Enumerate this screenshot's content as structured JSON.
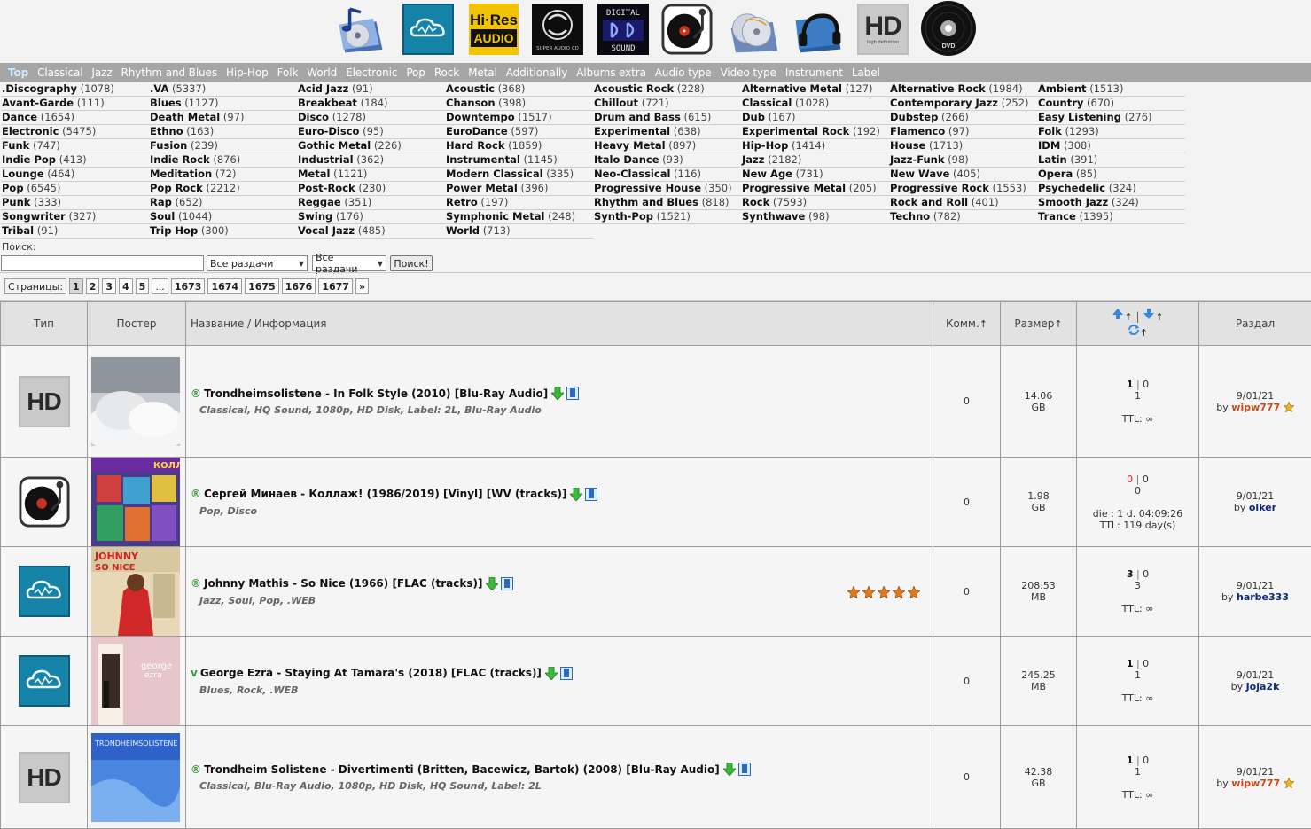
{
  "nav": [
    "Top",
    "Classical",
    "Jazz",
    "Rhythm and Blues",
    "Hip-Hop",
    "Folk",
    "World",
    "Electronic",
    "Pop",
    "Rock",
    "Metal",
    "Additionally",
    "Albums extra",
    "Audio type",
    "Video type",
    "Instrument",
    "Label"
  ],
  "top_icons": {
    "hires": {
      "line1": "Hi·Res",
      "line2": "AUDIO"
    },
    "sacd": {
      "text": "SUPER AUDIO CD"
    },
    "digital": {
      "line1": "DIGITAL",
      "line2": "SOUND"
    },
    "hd": {
      "text": "HD",
      "sub": "high definition"
    },
    "dvd": {
      "text": "DVD"
    }
  },
  "genres": [
    [
      {
        "name": ".Discography",
        "count": "(1078)"
      },
      {
        "name": "Avant-Garde",
        "count": "(111)"
      },
      {
        "name": "Dance",
        "count": "(1654)"
      },
      {
        "name": "Electronic",
        "count": "(5475)"
      },
      {
        "name": "Funk",
        "count": "(747)"
      },
      {
        "name": "Indie Pop",
        "count": "(413)"
      },
      {
        "name": "Lounge",
        "count": "(464)"
      },
      {
        "name": "Pop",
        "count": "(6545)"
      },
      {
        "name": "Punk",
        "count": "(333)"
      },
      {
        "name": "Songwriter",
        "count": "(327)"
      },
      {
        "name": "Tribal",
        "count": "(91)"
      }
    ],
    [
      {
        "name": ".VA",
        "count": "(5337)"
      },
      {
        "name": "Blues",
        "count": "(1127)"
      },
      {
        "name": "Death Metal",
        "count": "(97)"
      },
      {
        "name": "Ethno",
        "count": "(163)"
      },
      {
        "name": "Fusion",
        "count": "(239)"
      },
      {
        "name": "Indie Rock",
        "count": "(876)"
      },
      {
        "name": "Meditation",
        "count": "(72)"
      },
      {
        "name": "Pop Rock",
        "count": "(2212)"
      },
      {
        "name": "Rap",
        "count": "(652)"
      },
      {
        "name": "Soul",
        "count": "(1044)"
      },
      {
        "name": "Trip Hop",
        "count": "(300)"
      }
    ],
    [
      {
        "name": "Acid Jazz",
        "count": "(91)"
      },
      {
        "name": "Breakbeat",
        "count": "(184)"
      },
      {
        "name": "Disco",
        "count": "(1278)"
      },
      {
        "name": "Euro-Disco",
        "count": "(95)"
      },
      {
        "name": "Gothic Metal",
        "count": "(226)"
      },
      {
        "name": "Industrial",
        "count": "(362)"
      },
      {
        "name": "Metal",
        "count": "(1121)"
      },
      {
        "name": "Post-Rock",
        "count": "(230)"
      },
      {
        "name": "Reggae",
        "count": "(351)"
      },
      {
        "name": "Swing",
        "count": "(176)"
      },
      {
        "name": "Vocal Jazz",
        "count": "(485)"
      }
    ],
    [
      {
        "name": "Acoustic",
        "count": "(368)"
      },
      {
        "name": "Chanson",
        "count": "(398)"
      },
      {
        "name": "Downtempo",
        "count": "(1517)"
      },
      {
        "name": "EuroDance",
        "count": "(597)"
      },
      {
        "name": "Hard Rock",
        "count": "(1859)"
      },
      {
        "name": "Instrumental",
        "count": "(1145)"
      },
      {
        "name": "Modern Classical",
        "count": "(335)"
      },
      {
        "name": "Power Metal",
        "count": "(396)"
      },
      {
        "name": "Retro",
        "count": "(197)"
      },
      {
        "name": "Symphonic Metal",
        "count": "(248)"
      },
      {
        "name": "World",
        "count": "(713)"
      }
    ],
    [
      {
        "name": "Acoustic Rock",
        "count": "(228)"
      },
      {
        "name": "Chillout",
        "count": "(721)"
      },
      {
        "name": "Drum and Bass",
        "count": "(615)"
      },
      {
        "name": "Experimental",
        "count": "(638)"
      },
      {
        "name": "Heavy Metal",
        "count": "(897)"
      },
      {
        "name": "Italo Dance",
        "count": "(93)"
      },
      {
        "name": "Neo-Classical",
        "count": "(116)"
      },
      {
        "name": "Progressive House",
        "count": "(350)"
      },
      {
        "name": "Rhythm and Blues",
        "count": "(818)"
      },
      {
        "name": "Synth-Pop",
        "count": "(1521)"
      }
    ],
    [
      {
        "name": "Alternative Metal",
        "count": "(127)"
      },
      {
        "name": "Classical",
        "count": "(1028)"
      },
      {
        "name": "Dub",
        "count": "(167)"
      },
      {
        "name": "Experimental Rock",
        "count": "(192)"
      },
      {
        "name": "Hip-Hop",
        "count": "(1414)"
      },
      {
        "name": "Jazz",
        "count": "(2182)"
      },
      {
        "name": "New Age",
        "count": "(731)"
      },
      {
        "name": "Progressive Metal",
        "count": "(205)"
      },
      {
        "name": "Rock",
        "count": "(7593)"
      },
      {
        "name": "Synthwave",
        "count": "(98)"
      }
    ],
    [
      {
        "name": "Alternative Rock",
        "count": "(1984)"
      },
      {
        "name": "Contemporary Jazz",
        "count": "(252)"
      },
      {
        "name": "Dubstep",
        "count": "(266)"
      },
      {
        "name": "Flamenco",
        "count": "(97)"
      },
      {
        "name": "House",
        "count": "(1713)"
      },
      {
        "name": "Jazz-Funk",
        "count": "(98)"
      },
      {
        "name": "New Wave",
        "count": "(405)"
      },
      {
        "name": "Progressive Rock",
        "count": "(1553)"
      },
      {
        "name": "Rock and Roll",
        "count": "(401)"
      },
      {
        "name": "Techno",
        "count": "(782)"
      }
    ],
    [
      {
        "name": "Ambient",
        "count": "(1513)"
      },
      {
        "name": "Country",
        "count": "(670)"
      },
      {
        "name": "Easy Listening",
        "count": "(276)"
      },
      {
        "name": "Folk",
        "count": "(1293)"
      },
      {
        "name": "IDM",
        "count": "(308)"
      },
      {
        "name": "Latin",
        "count": "(391)"
      },
      {
        "name": "Opera",
        "count": "(85)"
      },
      {
        "name": "Psychedelic",
        "count": "(324)"
      },
      {
        "name": "Smooth Jazz",
        "count": "(324)"
      },
      {
        "name": "Trance",
        "count": "(1395)"
      }
    ]
  ],
  "search": {
    "label": "Поиск:",
    "value": "",
    "select1": "Все раздачи",
    "select2": "Все раздачи",
    "button": "Поиск!"
  },
  "pager": {
    "label": "Страницы:",
    "pages": [
      "1",
      "2",
      "3",
      "4",
      "5",
      "...",
      "1673",
      "1674",
      "1675",
      "1676",
      "1677",
      "»"
    ]
  },
  "table": {
    "headers": {
      "type": "Тип",
      "poster": "Постер",
      "name": "Название / Информация",
      "comments": "Комм.",
      "size": "Размер",
      "section": "Раздал"
    },
    "rows": [
      {
        "type_icon": "hd-icon",
        "poster": "poster-1",
        "status": "®",
        "title": "Trondheimsolistene - In Folk Style (2010) [Blu-Ray Audio]",
        "tags": "Classical, HQ Sound, 1080p, HD Disk, Label: 2L, Blu-Ray Audio",
        "comments": "0",
        "size_num": "14.06",
        "size_unit": "GB",
        "seed": "1",
        "leech": "0",
        "complete": "1",
        "extra": "",
        "ttl": "TTL: ∞",
        "date": "9/01/21",
        "by": "by",
        "user": "wipw777",
        "user_color": "red",
        "medal": true,
        "stars": 0
      },
      {
        "type_icon": "vinyl-icon",
        "poster": "poster-2",
        "status": "®",
        "title": "Сергей Минаев - Коллаж! (1986/2019) [Vinyl] [WV (tracks)]",
        "tags": "Pop, Disco",
        "comments": "0",
        "size_num": "1.98",
        "size_unit": "GB",
        "seed": "0",
        "leech": "0",
        "complete": "0",
        "extra": "die : 1 d. 04:09:26",
        "ttl": "TTL: 119 day(s)",
        "date": "9/01/21",
        "by": "by",
        "user": "olker",
        "user_color": "blue",
        "medal": false,
        "stars": 0
      },
      {
        "type_icon": "cloud-icon",
        "poster": "poster-3",
        "status": "®",
        "title": "Johnny Mathis - So Nice (1966) [FLAC (tracks)]",
        "tags": "Jazz, Soul, Pop, .WEB",
        "comments": "0",
        "size_num": "208.53",
        "size_unit": "MB",
        "seed": "3",
        "leech": "0",
        "complete": "3",
        "extra": "",
        "ttl": "TTL: ∞",
        "date": "9/01/21",
        "by": "by",
        "user": "harbe333",
        "user_color": "blue",
        "medal": false,
        "stars": 5
      },
      {
        "type_icon": "cloud-icon",
        "poster": "poster-4",
        "status": "v",
        "title": "George Ezra - Staying At Tamara's (2018) [FLAC (tracks)]",
        "tags": "Blues, Rock, .WEB",
        "comments": "0",
        "size_num": "245.25",
        "size_unit": "MB",
        "seed": "1",
        "leech": "0",
        "complete": "1",
        "extra": "",
        "ttl": "TTL: ∞",
        "date": "9/01/21",
        "by": "by",
        "user": "Joja2k",
        "user_color": "blue",
        "medal": false,
        "stars": 0
      },
      {
        "type_icon": "hd-icon",
        "poster": "poster-5",
        "status": "®",
        "title": "Trondheim Solistene - Divertimenti (Britten, Bacewicz, Bartok) (2008) [Blu-Ray Audio]",
        "tags": "Classical, Blu-Ray Audio, 1080p, HD Disk, HQ Sound, Label: 2L",
        "comments": "0",
        "size_num": "42.38",
        "size_unit": "GB",
        "seed": "1",
        "leech": "0",
        "complete": "1",
        "extra": "",
        "ttl": "TTL: ∞",
        "date": "9/01/21",
        "by": "by",
        "user": "wipw777",
        "user_color": "red",
        "medal": true,
        "stars": 0
      }
    ]
  },
  "colors": {
    "nav_bg": "#a6a6a6",
    "accent_green": "#3a9a3a",
    "user_red": "#d24a1a",
    "user_blue": "#102a7a",
    "star": "#e07a1a"
  }
}
